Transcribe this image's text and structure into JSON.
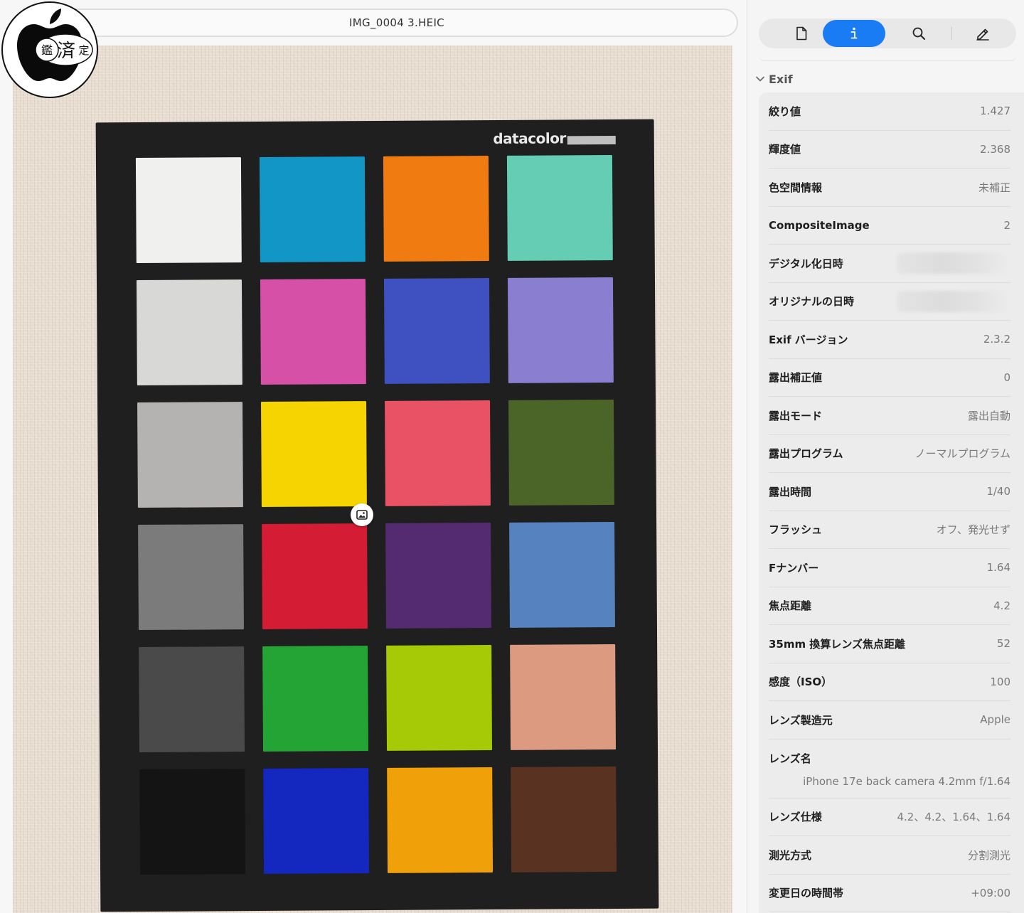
{
  "window": {
    "file_title": "IMG_0004 3.HEIC"
  },
  "logo": {
    "text": "鑑済定"
  },
  "chart": {
    "brand": "datacolor",
    "patches": [
      "#f0f0ee",
      "#1196c6",
      "#f07b10",
      "#64cdb4",
      "#d8d8d6",
      "#d650a8",
      "#3f50c0",
      "#8a7ed0",
      "#b4b3b2",
      "#f5d402",
      "#e85264",
      "#4b6529",
      "#7b7b7b",
      "#d41c34",
      "#542a70",
      "#5682c0",
      "#4a4a4a",
      "#23a434",
      "#a6ca06",
      "#dc9a80",
      "#141414",
      "#1427be",
      "#f0a008",
      "#5a3222"
    ]
  },
  "toolbar": {
    "tabs": [
      {
        "name": "file",
        "icon": "document-icon"
      },
      {
        "name": "info",
        "icon": "info-icon",
        "active": true
      },
      {
        "name": "search",
        "icon": "search-icon"
      },
      {
        "name": "markup",
        "icon": "pencil-icon"
      }
    ],
    "accent": "#1a7cf5"
  },
  "exif": {
    "section_title": "Exif",
    "rows": [
      {
        "label": "絞り値",
        "value": "1.427"
      },
      {
        "label": "輝度値",
        "value": "2.368"
      },
      {
        "label": "色空間情報",
        "value": "未補正"
      },
      {
        "label": "CompositeImage",
        "value": "2"
      },
      {
        "label": "デジタル化日時",
        "value": ""
      },
      {
        "label": "オリジナルの日時",
        "value": ""
      },
      {
        "label": "Exif バージョン",
        "value": "2.3.2"
      },
      {
        "label": "露出補正値",
        "value": "0"
      },
      {
        "label": "露出モード",
        "value": "露出自動"
      },
      {
        "label": "露出プログラム",
        "value": "ノーマルプログラム"
      },
      {
        "label": "露出時間",
        "value": "1/40"
      },
      {
        "label": "フラッシュ",
        "value": "オフ、発光せず"
      },
      {
        "label": "Fナンバー",
        "value": "1.64"
      },
      {
        "label": "焦点距離",
        "value": "4.2"
      },
      {
        "label": "35mm 換算レンズ焦点距離",
        "value": "52"
      },
      {
        "label": "感度（ISO）",
        "value": "100"
      },
      {
        "label": "レンズ製造元",
        "value": "Apple"
      },
      {
        "label": "レンズ名",
        "value": "iPhone 17e back camera 4.2mm f/1.64"
      },
      {
        "label": "レンズ仕様",
        "value": "4.2、4.2、1.64、1.64"
      },
      {
        "label": "測光方式",
        "value": "分割測光"
      },
      {
        "label": "変更日の時間帯",
        "value": "+09:00"
      }
    ]
  }
}
